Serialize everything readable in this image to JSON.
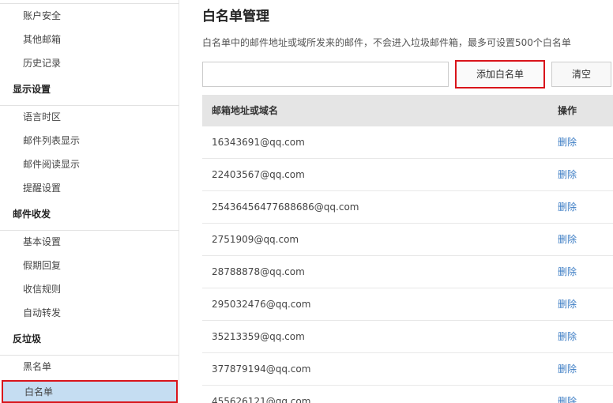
{
  "sidebar": {
    "items": [
      {
        "label": "账户安全",
        "type": "item"
      },
      {
        "label": "其他邮箱",
        "type": "item"
      },
      {
        "label": "历史记录",
        "type": "item"
      },
      {
        "label": "显示设置",
        "type": "header"
      },
      {
        "label": "语言时区",
        "type": "item"
      },
      {
        "label": "邮件列表显示",
        "type": "item"
      },
      {
        "label": "邮件阅读显示",
        "type": "item"
      },
      {
        "label": "提醒设置",
        "type": "item"
      },
      {
        "label": "邮件收发",
        "type": "header"
      },
      {
        "label": "基本设置",
        "type": "item"
      },
      {
        "label": "假期回复",
        "type": "item"
      },
      {
        "label": "收信规则",
        "type": "item"
      },
      {
        "label": "自动转发",
        "type": "item"
      },
      {
        "label": "反垃圾",
        "type": "header"
      },
      {
        "label": "黑名单",
        "type": "item"
      },
      {
        "label": "白名单",
        "type": "item",
        "active": true
      }
    ]
  },
  "main": {
    "title": "白名单管理",
    "description": "白名单中的邮件地址或域所发来的邮件，不会进入垃圾邮件箱，最多可设置500个白名单",
    "input_value": "",
    "add_button": "添加白名单",
    "clear_button": "清空",
    "table": {
      "headers": {
        "address": "邮箱地址或域名",
        "operation": "操作"
      },
      "rows": [
        {
          "address": "16343691@qq.com",
          "action": "删除"
        },
        {
          "address": "22403567@qq.com",
          "action": "删除"
        },
        {
          "address": "25436456477688686@qq.com",
          "action": "删除"
        },
        {
          "address": "2751909@qq.com",
          "action": "删除"
        },
        {
          "address": "28788878@qq.com",
          "action": "删除"
        },
        {
          "address": "295032476@qq.com",
          "action": "删除"
        },
        {
          "address": "35213359@qq.com",
          "action": "删除"
        },
        {
          "address": "377879194@qq.com",
          "action": "删除"
        },
        {
          "address": "455626121@qq.com",
          "action": "删除"
        }
      ]
    }
  },
  "colors": {
    "highlight_border": "#d9141b",
    "active_item_bg": "#c5ddf2",
    "link": "#3b7cc4",
    "table_header_bg": "#e5e5e5"
  }
}
